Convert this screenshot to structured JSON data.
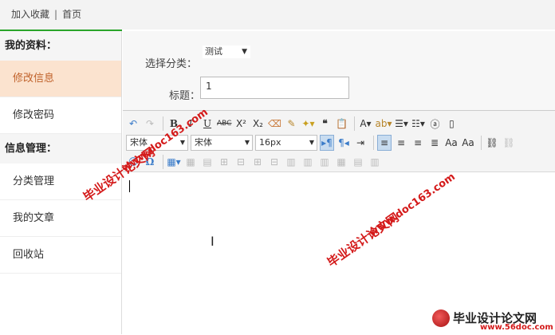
{
  "topbar": {
    "links": [
      "加入收藏",
      "首页"
    ],
    "sep": "|"
  },
  "sidebar": {
    "sections": [
      {
        "heading": "我的资料：",
        "items": [
          {
            "label": "修改信息",
            "active": true
          },
          {
            "label": "修改密码",
            "active": false
          }
        ]
      },
      {
        "heading": "信息管理：",
        "items": [
          {
            "label": "分类管理",
            "active": false
          },
          {
            "label": "我的文章",
            "active": false
          },
          {
            "label": "回收站",
            "active": false
          }
        ]
      }
    ]
  },
  "form": {
    "category_label": "选择分类：",
    "category_value": "测试",
    "title_label": "标题：",
    "title_value": "1"
  },
  "editor": {
    "font_family_value": "宋体",
    "font_family_value2": "宋体",
    "font_size_value": "16px",
    "text_content": ""
  },
  "watermarks": [
    {
      "text": "毕业设计论文网"
    },
    {
      "text": "www.doc163.com"
    }
  ],
  "logo": {
    "title": "毕业设计论文网",
    "url": "www.56doc.com"
  },
  "colors": {
    "accent_green": "#2aa52a",
    "active_bg": "#fbe3cf",
    "watermark_red": "#d41a1a"
  }
}
